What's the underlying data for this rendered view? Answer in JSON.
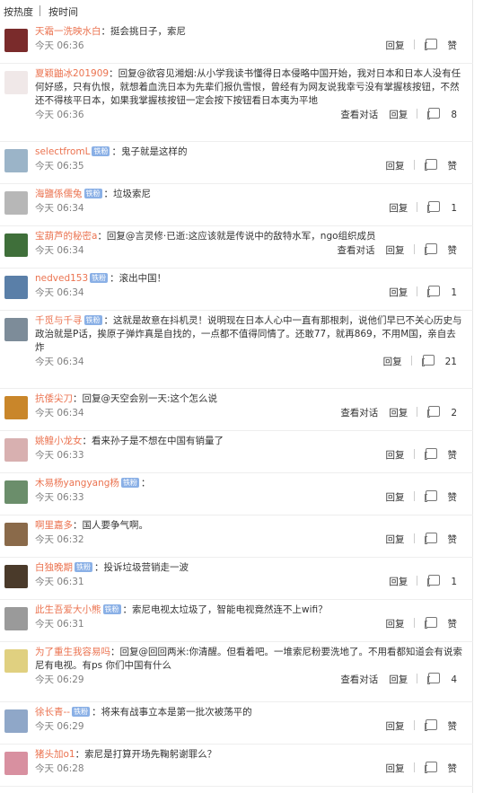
{
  "tabs": {
    "hot": "按热度",
    "time": "按时间"
  },
  "labels": {
    "reply": "回复",
    "view_conv": "查看对话",
    "like_word": "赞",
    "vip_badge": "铁粉"
  },
  "comments": [
    {
      "user": "天霜一洗映水白",
      "vip": false,
      "text": "：挺会挑日子，索尼",
      "time": "今天 06:36",
      "likes": "",
      "conv": false,
      "av": "#7a2b2b"
    },
    {
      "user": "夏颖鼬冰201909",
      "vip": false,
      "text": "：回复@欲容见湘烟:从小学我读书懂得日本侵略中国开始，我对日本和日本人没有任何好感，只有仇恨，就想着血洗日本为先辈们报仇雪恨，曾经有为网友说我幸亏没有掌握核按钮，不然还不得核平日本，如果我掌握核按钮一定会按下按钮看日本夷为平地",
      "time": "今天 06:36",
      "likes": "8",
      "conv": true,
      "av": "#f0e8e8"
    },
    {
      "user": "selectfromL",
      "vip": true,
      "text": "：鬼子就是这样的",
      "time": "今天 06:35",
      "likes": "",
      "conv": false,
      "av": "#9bb4c8"
    },
    {
      "user": "海鹽係儒兔",
      "vip": true,
      "text": "：垃圾索尼",
      "time": "今天 06:34",
      "likes": "1",
      "conv": false,
      "av": "#b7b7b7"
    },
    {
      "user": "宝葫芦的秘密a",
      "vip": false,
      "text": "：回复@言灵修·已逝:这应该就是传说中的敌特水军，ngo组织成员",
      "time": "今天 06:34",
      "likes": "",
      "conv": true,
      "av": "#3f6f3a"
    },
    {
      "user": "nedved153",
      "vip": true,
      "text": "：滚出中国！",
      "time": "今天 06:34",
      "likes": "1",
      "conv": false,
      "av": "#5a7fa8"
    },
    {
      "user": "千觅与千寻",
      "vip": true,
      "text": "：这就是故意在抖机灵！说明现在日本人心中一直有那根刺，说他们早已不关心历史与政治就是P话，挨原子弹炸真是自找的，一点都不值得同情了。还敢77，就再869，不用M国，亲自去炸",
      "time": "今天 06:34",
      "likes": "21",
      "conv": false,
      "av": "#7d8c99"
    },
    {
      "user": "抗倭尖刀",
      "vip": false,
      "text": "：回复@天空会别一天:这个怎么说",
      "time": "今天 06:34",
      "likes": "2",
      "conv": true,
      "av": "#c9862a"
    },
    {
      "user": "姚鳇小龙女",
      "vip": false,
      "text": "：看来孙子是不想在中国有销量了",
      "time": "今天 06:33",
      "likes": "",
      "conv": false,
      "av": "#d8b0b0"
    },
    {
      "user": "木易杨yangyang杨",
      "vip": true,
      "text": "：",
      "time": "今天 06:33",
      "likes": "",
      "conv": false,
      "av": "#6b8e6b"
    },
    {
      "user": "啊里嘉多",
      "vip": false,
      "text": "：国人要争气啊。",
      "time": "今天 06:32",
      "likes": "",
      "conv": false,
      "av": "#8a6a4a"
    },
    {
      "user": "白独晚期",
      "vip": true,
      "text": "：投诉垃圾营销走一波",
      "time": "今天 06:31",
      "likes": "1",
      "conv": false,
      "av": "#4a3a2a"
    },
    {
      "user": "此生吾爱大小熊",
      "vip": true,
      "text": "：索尼电视太垃圾了，智能电视竟然连不上wifi？",
      "time": "今天 06:31",
      "likes": "",
      "conv": false,
      "av": "#9a9a9a"
    },
    {
      "user": "为了重生我容易吗",
      "vip": false,
      "text": "：回复@回回两米:你清醒。但看着吧。一堆索尼粉要洗地了。不用看都知道会有说索尼有电视。有ps 你们中国有什么",
      "time": "今天 06:29",
      "likes": "4",
      "conv": true,
      "av": "#e0d080"
    },
    {
      "user": "徐长青--",
      "vip": true,
      "text": "：将来有战事立本是第一批次被荡平的",
      "time": "今天 06:29",
      "likes": "",
      "conv": false,
      "av": "#8fa7c8"
    },
    {
      "user": "猪头加o1",
      "vip": false,
      "text": "：索尼是打算开场先鞠躬谢罪么？",
      "time": "今天 06:28",
      "likes": "",
      "conv": false,
      "av": "#d890a0"
    }
  ]
}
